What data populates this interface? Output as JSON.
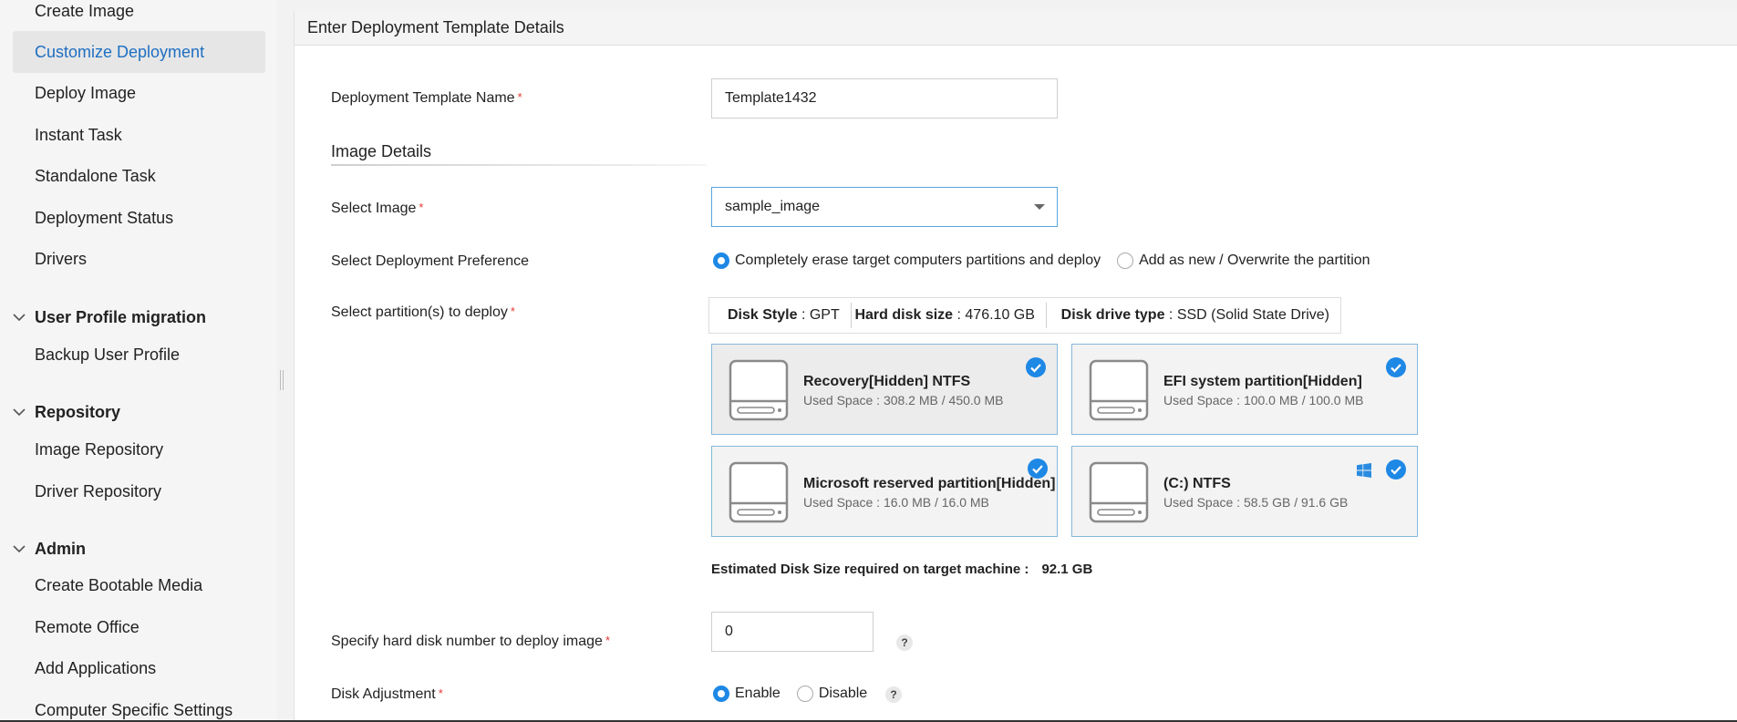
{
  "sidebar": {
    "items": [
      {
        "label": "Create Image"
      },
      {
        "label": "Customize Deployment",
        "active": true
      },
      {
        "label": "Deploy Image"
      },
      {
        "label": "Instant Task"
      },
      {
        "label": "Standalone Task"
      },
      {
        "label": "Deployment Status"
      },
      {
        "label": "Drivers"
      }
    ],
    "sections": [
      {
        "title": "User Profile migration",
        "items": [
          {
            "label": "Backup User Profile"
          }
        ]
      },
      {
        "title": "Repository",
        "items": [
          {
            "label": "Image Repository"
          },
          {
            "label": "Driver Repository"
          }
        ]
      },
      {
        "title": "Admin",
        "items": [
          {
            "label": "Create Bootable Media"
          },
          {
            "label": "Remote Office"
          },
          {
            "label": "Add Applications"
          },
          {
            "label": "Computer Specific Settings"
          }
        ]
      }
    ]
  },
  "main": {
    "header_title": "Enter Deployment Template Details",
    "template_name": {
      "label": "Deployment Template Name",
      "required_mark": "*",
      "value": "Template1432"
    },
    "image_details_title": "Image Details",
    "select_image": {
      "label": "Select Image",
      "required_mark": "*",
      "value": "sample_image"
    },
    "deployment_preference": {
      "label": "Select Deployment Preference",
      "options": [
        {
          "label": "Completely erase target computers partitions and deploy",
          "selected": true
        },
        {
          "label": "Add as new / Overwrite the partition",
          "selected": false
        }
      ]
    },
    "partitions": {
      "label": "Select partition(s) to deploy",
      "required_mark": "*",
      "disk_style_label": "Disk Style",
      "disk_style_value": ": GPT",
      "hard_disk_size_label": "Hard disk size",
      "hard_disk_size_value": ": 476.10 GB",
      "disk_drive_type_label": "Disk drive type",
      "disk_drive_type_value": ": SSD (Solid State Drive)",
      "items": [
        {
          "name": "Recovery[Hidden] NTFS",
          "used": "Used Space : 308.2 MB / 450.0 MB",
          "checked": true,
          "windows": false
        },
        {
          "name": "EFI system partition[Hidden]",
          "used": "Used Space : 100.0 MB / 100.0 MB",
          "checked": true,
          "windows": false
        },
        {
          "name": "Microsoft reserved partition[Hidden]",
          "used": "Used Space : 16.0 MB / 16.0 MB",
          "checked": true,
          "windows": false
        },
        {
          "name": "(C:) NTFS",
          "used": "Used Space : 58.5 GB / 91.6 GB",
          "checked": true,
          "windows": true
        }
      ]
    },
    "estimated": {
      "label": "Estimated Disk Size required on target machine :",
      "value": "92.1 GB"
    },
    "hard_disk_number": {
      "label": "Specify hard disk number to deploy image",
      "required_mark": "*",
      "value": "0",
      "help": "?"
    },
    "disk_adjustment": {
      "label": "Disk Adjustment",
      "required_mark": "*",
      "options": [
        {
          "label": "Enable",
          "selected": true
        },
        {
          "label": "Disable",
          "selected": false
        }
      ],
      "help": "?"
    }
  },
  "colors": {
    "accent": "#1e88e5",
    "active_nav": "#1e6fc3",
    "required": "#e53935"
  }
}
